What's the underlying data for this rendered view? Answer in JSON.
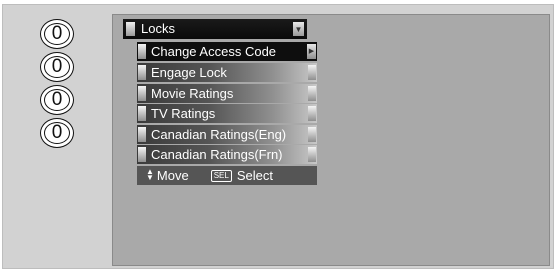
{
  "callouts": [
    "0",
    "0",
    "0",
    "0"
  ],
  "menu": {
    "title": "Locks",
    "items": [
      {
        "label": "Change Access Code",
        "selected": true
      },
      {
        "label": "Engage Lock",
        "selected": false
      },
      {
        "label": "Movie Ratings",
        "selected": false
      },
      {
        "label": "TV Ratings",
        "selected": false
      },
      {
        "label": "Canadian Ratings(Eng)",
        "selected": false
      },
      {
        "label": "Canadian Ratings(Frn)",
        "selected": false
      }
    ]
  },
  "help": {
    "move_label": "Move",
    "sel_key": "SEL",
    "select_label": "Select"
  },
  "icons": {
    "dropdown": "triangle-down-icon",
    "selected_arrow": "triangle-right-icon",
    "move": "up-down-arrows-icon"
  }
}
